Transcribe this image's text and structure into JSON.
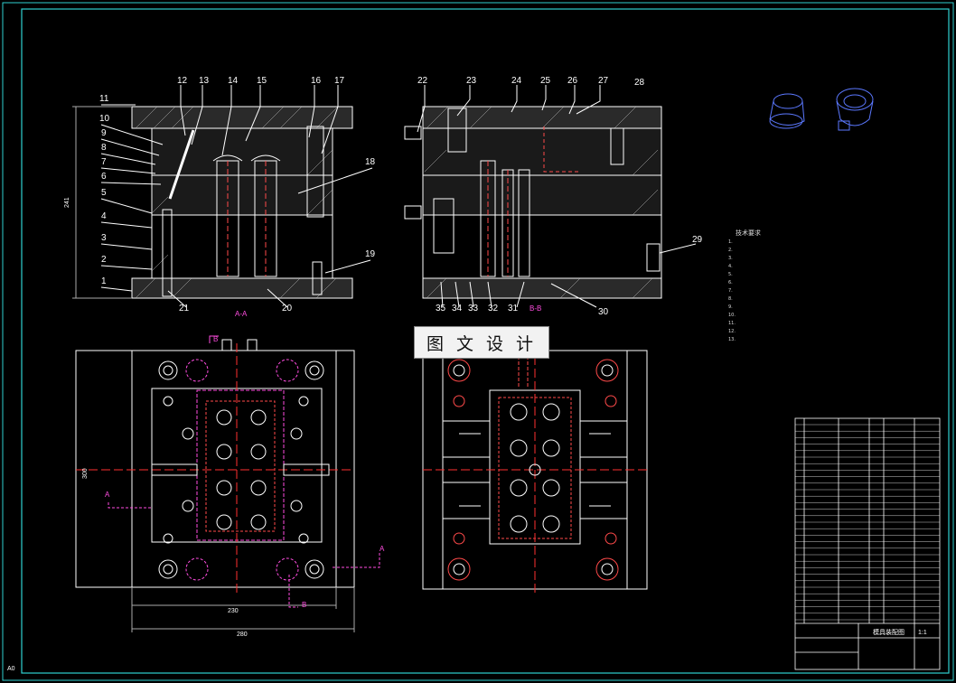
{
  "drawing": {
    "watermark_text": "图 文 设 计",
    "corner_label": "A0",
    "colors": {
      "background": "#000000",
      "frame": "#2fd0d0",
      "line": "#ffffff",
      "hidden": "#ff4a4a",
      "magenta": "#ff4de0",
      "axis": "#ff3030"
    }
  },
  "front_view": {
    "part_numbers_top": [
      "12",
      "13",
      "14",
      "15",
      "16",
      "17"
    ],
    "part_numbers_left": [
      "11",
      "10",
      "9",
      "8",
      "7",
      "6",
      "5",
      "4",
      "3",
      "2",
      "1"
    ],
    "part_numbers_right": [
      "18",
      "19"
    ],
    "part_numbers_bottom": [
      "21",
      "20"
    ],
    "height_dim": "241",
    "section_label": "A-A"
  },
  "side_view": {
    "part_numbers_top": [
      "22",
      "23",
      "24",
      "25",
      "26",
      "27",
      "28"
    ],
    "part_numbers_right": [
      "29",
      "30"
    ],
    "part_numbers_bottom": [
      "35",
      "34",
      "33",
      "32",
      "31"
    ],
    "section_label": "B-B"
  },
  "plan_view": {
    "width_inner_dim": "230",
    "width_outer_dim": "280",
    "height_dim": "300",
    "section_marks": [
      "B",
      "A",
      "A",
      "B"
    ]
  },
  "notes": {
    "title": "技术要求",
    "lines": [
      "1.",
      "2.",
      "3.",
      "4.",
      "5.",
      "6.",
      "7.",
      "8.",
      "9.",
      "10.",
      "11.",
      "12.",
      "13."
    ]
  },
  "title_block": {
    "drawing_name": "模具装配图",
    "scale": "1:1"
  }
}
